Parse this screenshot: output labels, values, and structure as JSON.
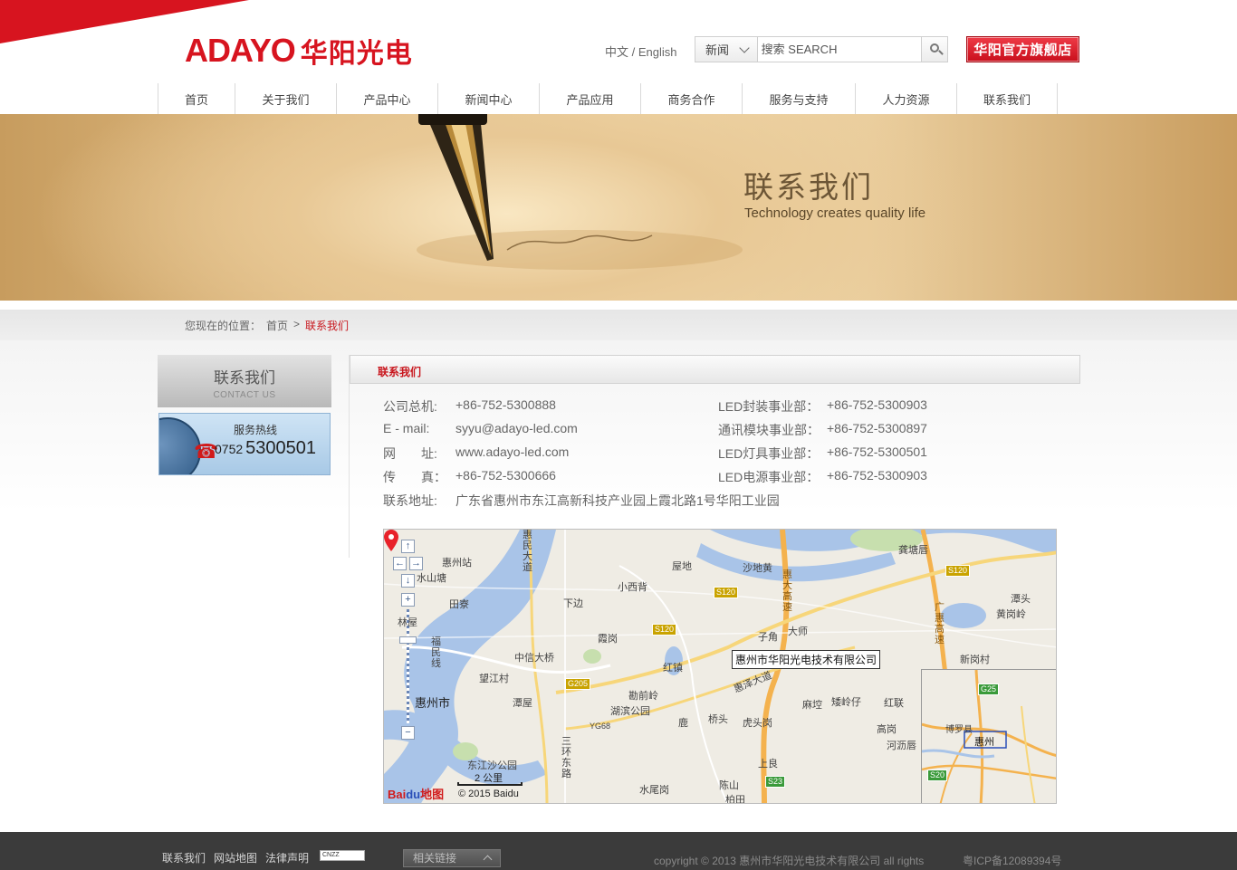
{
  "header": {
    "logo_latin": "ADAYO",
    "logo_cn": "华阳光电",
    "lang_switch": "中文 / English",
    "search": {
      "category": "新闻",
      "placeholder": "搜索 SEARCH"
    },
    "flagship_label": "华阳官方旗舰店"
  },
  "nav": {
    "items": [
      {
        "label": "首页"
      },
      {
        "label": "关于我们"
      },
      {
        "label": "产品中心"
      },
      {
        "label": "新闻中心"
      },
      {
        "label": "产品应用"
      },
      {
        "label": "商务合作"
      },
      {
        "label": "服务与支持"
      },
      {
        "label": "人力资源"
      },
      {
        "label": "联系我们"
      }
    ]
  },
  "banner": {
    "title": "联系我们",
    "subtitle": "Technology creates quality life"
  },
  "breadcrumb": {
    "prefix": "您现在的位置：",
    "home": "首页",
    "sep": ">",
    "current": "联系我们"
  },
  "sidebar": {
    "title_cn": "联系我们",
    "title_en": "CONTACT US",
    "hotline_label": "服务热线",
    "hotline_area": "0752",
    "hotline_number": "5300501"
  },
  "panel": {
    "title": "联系我们",
    "contacts_left": [
      {
        "label": "公司总机:",
        "value": "+86-752-5300888"
      },
      {
        "label": "E - mail:",
        "value": "syyu@adayo-led.com"
      },
      {
        "label": "网　　址:",
        "value": "www.adayo-led.com"
      },
      {
        "label": "传　　真：",
        "value": "+86-752-5300666"
      }
    ],
    "contacts_right": [
      {
        "label": "LED封装事业部：",
        "value": "+86-752-5300903"
      },
      {
        "label": "通讯模块事业部：",
        "value": "+86-752-5300897"
      },
      {
        "label": "LED灯具事业部：",
        "value": "+86-752-5300501"
      },
      {
        "label": "LED电源事业部：",
        "value": "+86-752-5300903"
      }
    ],
    "address": {
      "label": "联系地址:",
      "value": "广东省惠州市东江高新科技产业园上霞北路1号华阳工业园"
    }
  },
  "map": {
    "marker_label": "惠州市华阳光电技术有限公司",
    "scale": "2 公里",
    "copyright": "© 2015 Baidu",
    "brand": "Bai",
    "brand_paw": "du",
    "brand_suffix": "地图",
    "places": [
      "惠州站",
      "水山塘",
      "田寮",
      "林屋",
      "福民线",
      "惠州市",
      "惠民大道",
      "小西背",
      "下边",
      "霞岗",
      "屋地",
      "沙地黄",
      "中信大桥",
      "望江村",
      "潭屋",
      "湖滨公园",
      "勘前岭",
      "红镇",
      "惠泽大道",
      "子角",
      "大师",
      "桥头",
      "虎头岗",
      "麻埪",
      "矮岭仔",
      "红联",
      "高岗",
      "河沥唇",
      "上良",
      "陈山",
      "柏田",
      "水尾岗",
      "东江沙公园",
      "三环东路",
      "鹿",
      "龚塘唇",
      "潭头",
      "黄岗岭",
      "新岗村",
      "惠大高速",
      "广惠高速",
      "博罗县",
      "惠州"
    ],
    "shields": [
      "S120",
      "S120",
      "S120",
      "G205",
      "YG68",
      "S23",
      "G25",
      "S20"
    ]
  },
  "footer": {
    "links": [
      {
        "label": "联系我们"
      },
      {
        "label": "网站地图"
      },
      {
        "label": "法律声明"
      }
    ],
    "cnzz": "CNZZ",
    "related_label": "相关链接",
    "copyright": "copyright © 2013 惠州市华阳光电技术有限公司 all rights",
    "icp": "粤ICP备12089394号"
  },
  "colors": {
    "brand_red": "#d7141f",
    "link_red": "#c8161d",
    "footer_bg": "#3b3b3b"
  }
}
